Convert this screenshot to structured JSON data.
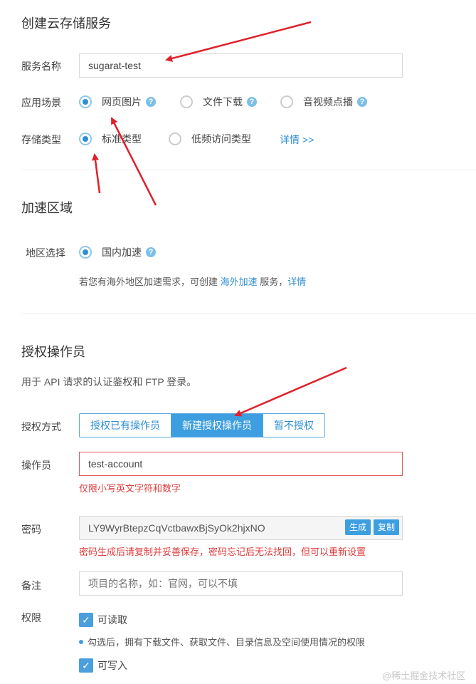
{
  "create": {
    "title": "创建云存储服务",
    "service_name_label": "服务名称",
    "service_name_value": "sugarat-test",
    "scene_label": "应用场景",
    "scene_options": [
      "网页图片",
      "文件下载",
      "音视频点播"
    ],
    "storage_label": "存储类型",
    "storage_options": [
      "标准类型",
      "低频访问类型"
    ],
    "storage_detail_link": "详情 >>"
  },
  "accel": {
    "title": "加速区域",
    "region_label": "地区选择",
    "region_option": "国内加速",
    "note_prefix": "若您有海外地区加速需求，可创建",
    "note_link": "海外加速",
    "note_middle": "服务，",
    "note_detail_link": "详情"
  },
  "operator": {
    "title": "授权操作员",
    "desc": "用于 API 请求的认证鉴权和 FTP 登录。",
    "method_label": "授权方式",
    "methods": [
      "授权已有操作员",
      "新建授权操作员",
      "暂不授权"
    ],
    "operator_label": "操作员",
    "operator_value": "test-account",
    "operator_hint": "仅限小写英文字符和数字",
    "password_label": "密码",
    "password_value": "LY9WyrBtepzCqVctbawxBjSyOk2hjxNO",
    "generate_btn": "生成",
    "copy_btn": "复制",
    "password_hint": "密码生成后请复制并妥善保存，密码忘记后无法找回，但可以重新设置",
    "remark_label": "备注",
    "remark_placeholder": "项目的名称，如：官网，可以不填",
    "perm_label": "权限",
    "perm_read": "可读取",
    "perm_read_desc": "勾选后，拥有下载文件、获取文件、目录信息及空间使用情况的权限",
    "perm_write": "可写入"
  },
  "watermark": "@稀土掘金技术社区",
  "colors": {
    "accent": "#3d9ee0",
    "annotation_arrow": "#e0202a",
    "error": "#e03b3b"
  }
}
